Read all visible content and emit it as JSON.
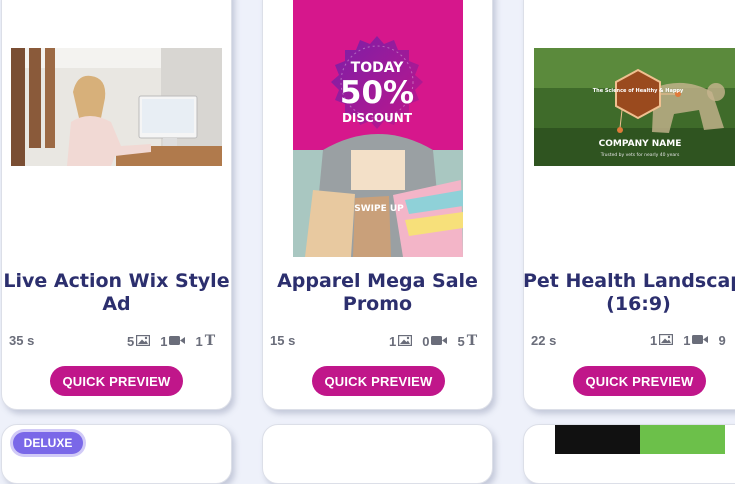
{
  "cards": [
    {
      "title_line1": "Live Action Wix Style",
      "title_line2": "Ad",
      "duration": "35 s",
      "images": "5",
      "videos": "1",
      "texts": "1",
      "button": "QUICK PREVIEW"
    },
    {
      "title_line1": "Apparel Mega Sale",
      "title_line2": "Promo",
      "duration": "15 s",
      "images": "1",
      "videos": "0",
      "texts": "5",
      "button": "QUICK PREVIEW",
      "thumb_text": {
        "today": "TODAY",
        "percent": "50%",
        "discount": "DISCOUNT",
        "swipe": "SWIPE UP"
      }
    },
    {
      "title_line1": "Pet Health Landscape",
      "title_line2": "(16:9)",
      "duration": "22 s",
      "images": "1",
      "videos": "1",
      "texts": "9",
      "button": "QUICK PREVIEW",
      "thumb_text": {
        "hex_text": "The Science of Healthy & Happy",
        "company": "COMPANY NAME",
        "tagline": "Trusted by vets for nearly 40 years"
      }
    }
  ],
  "badge": "DELUXE",
  "colors": {
    "accent": "#c0168a",
    "title": "#2c2f6e",
    "badge": "#7a68e8",
    "background": "#eef1fa"
  },
  "icons": {
    "images": "image-icon",
    "videos": "video-camera-icon",
    "texts": "text-icon"
  }
}
